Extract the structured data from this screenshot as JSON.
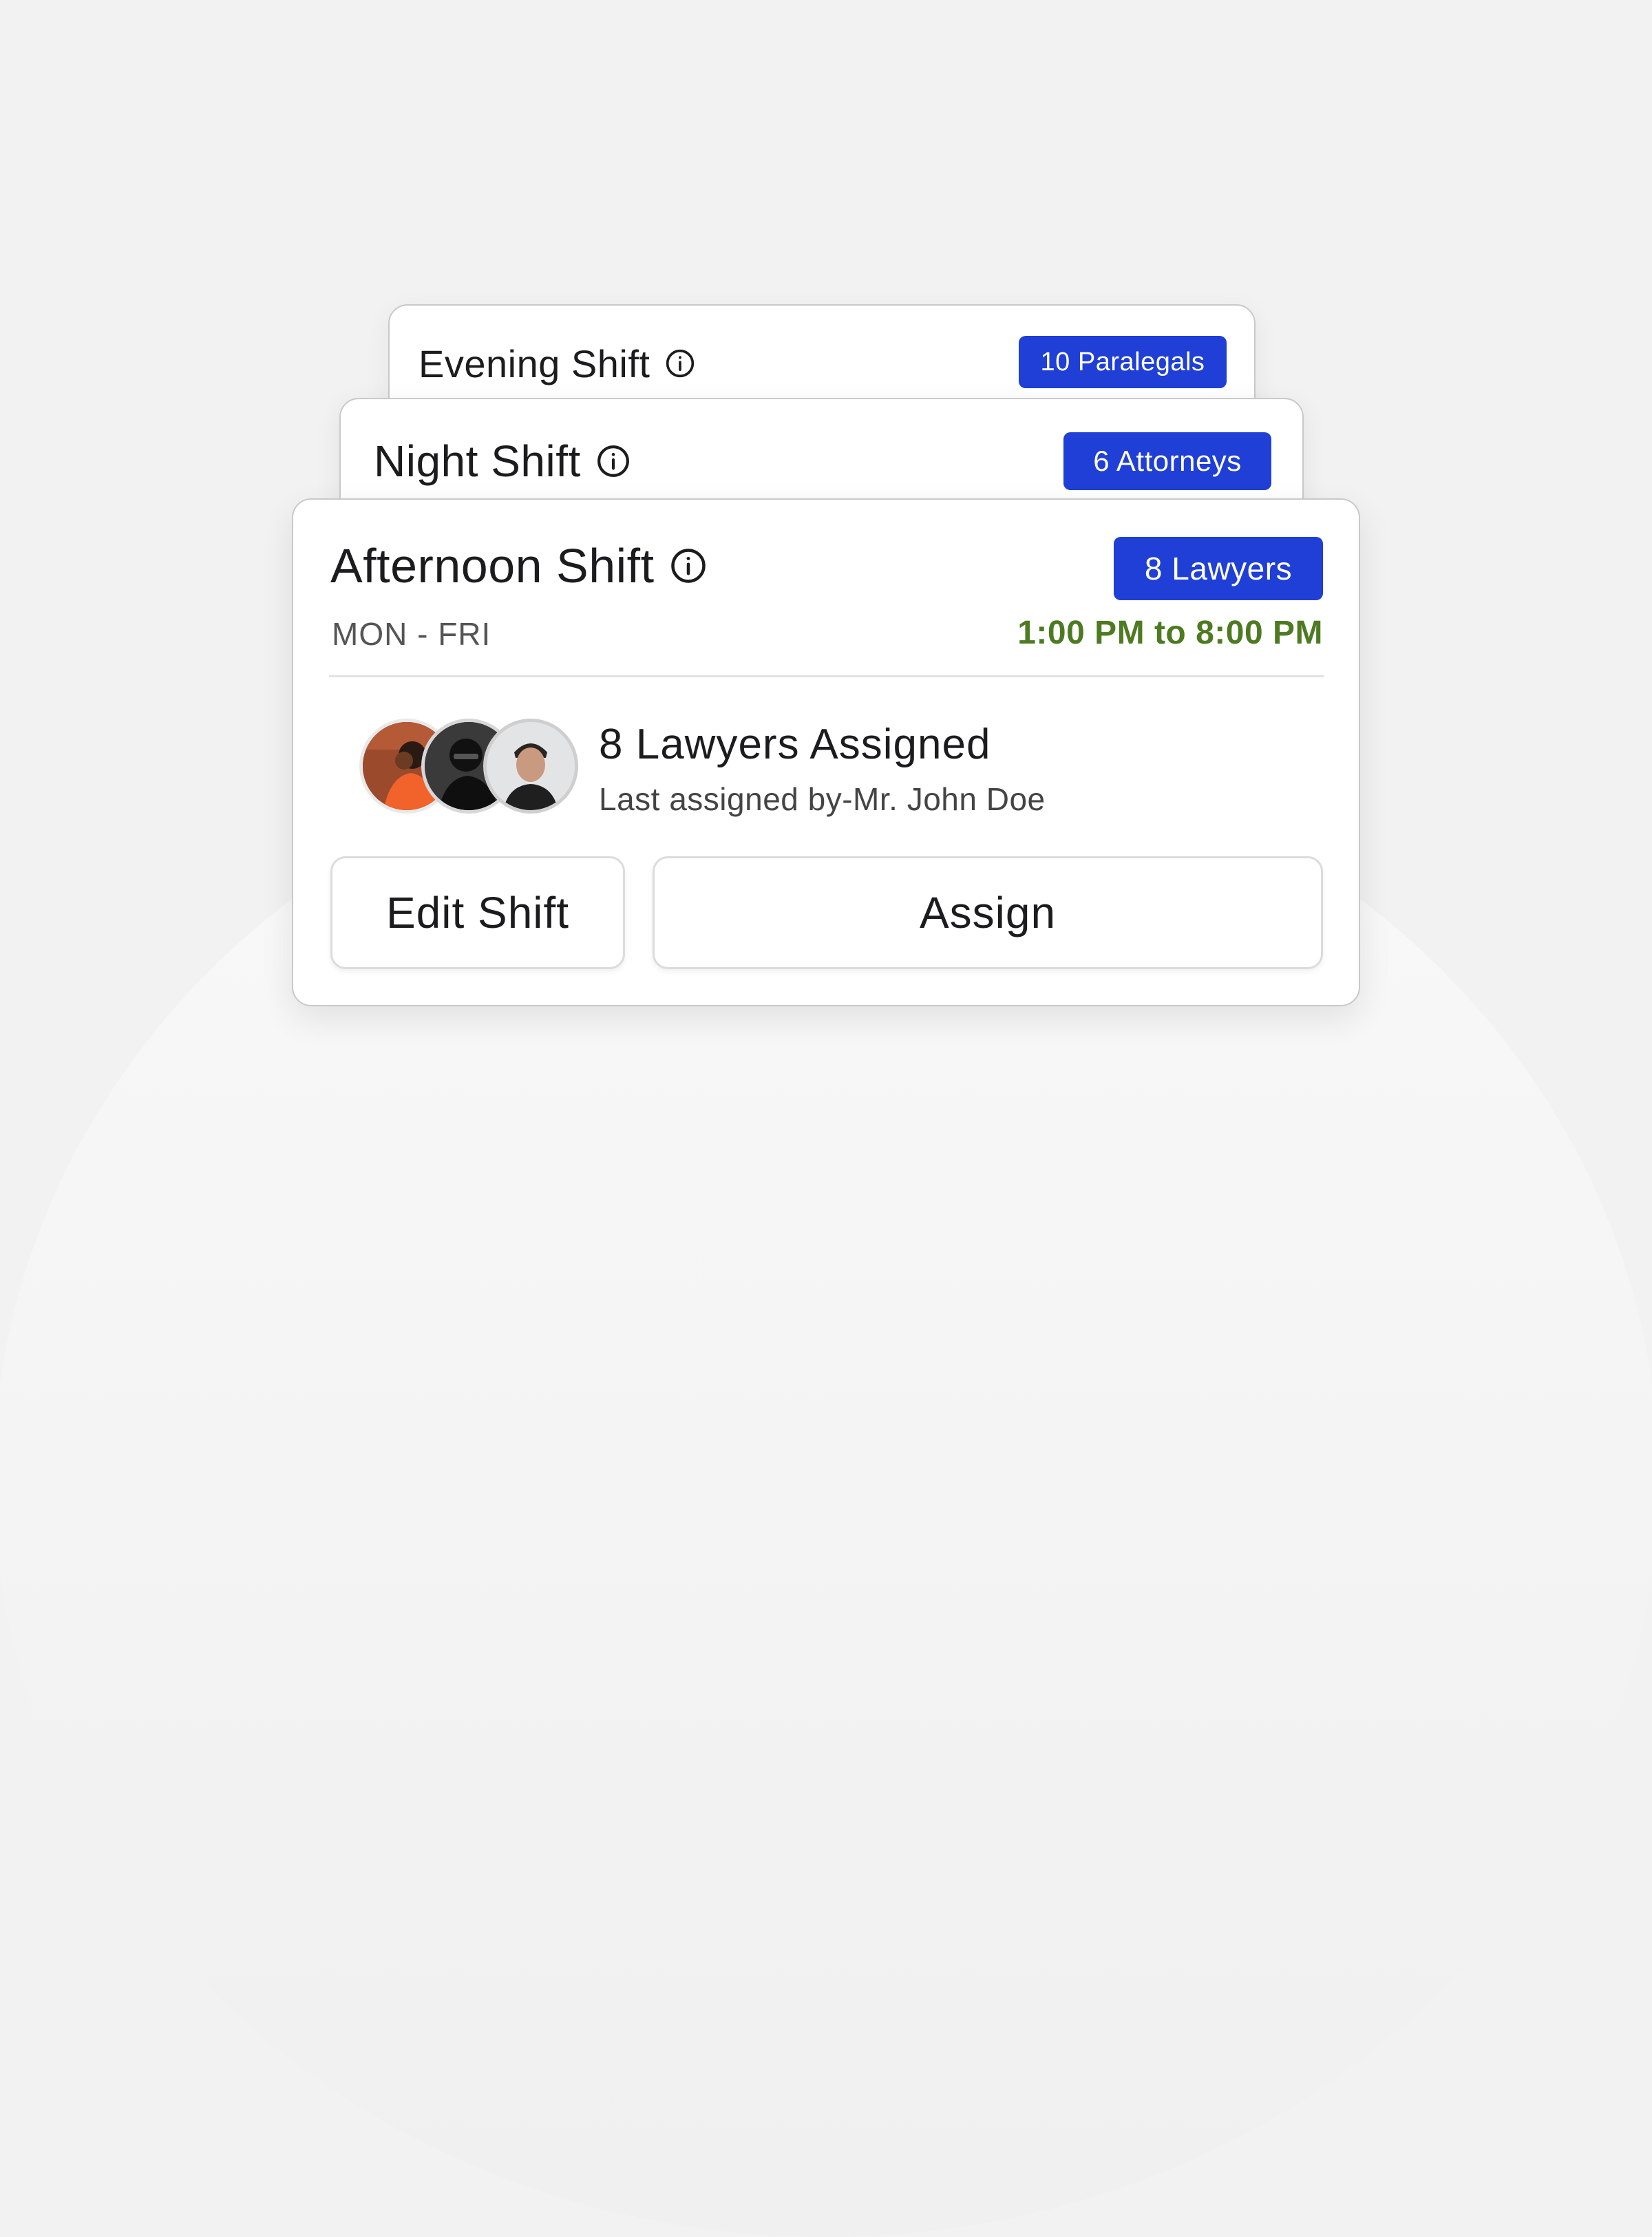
{
  "cards": {
    "evening": {
      "title": "Evening Shift",
      "badge": "10 Paralegals"
    },
    "night": {
      "title": "Night Shift",
      "badge": "6 Attorneys"
    },
    "afternoon": {
      "title": "Afternoon Shift",
      "badge": "8 Lawyers",
      "days": "MON - FRI",
      "hours": "1:00 PM to 8:00 PM",
      "assigned_title": "8 Lawyers Assigned",
      "assigned_sub": "Last assigned by-Mr. John Doe",
      "edit_label": "Edit Shift",
      "assign_label": "Assign"
    }
  },
  "icons": {
    "info": "info-circle-icon"
  },
  "colors": {
    "badge": "#1f3fd6",
    "hours": "#4e7a22"
  }
}
